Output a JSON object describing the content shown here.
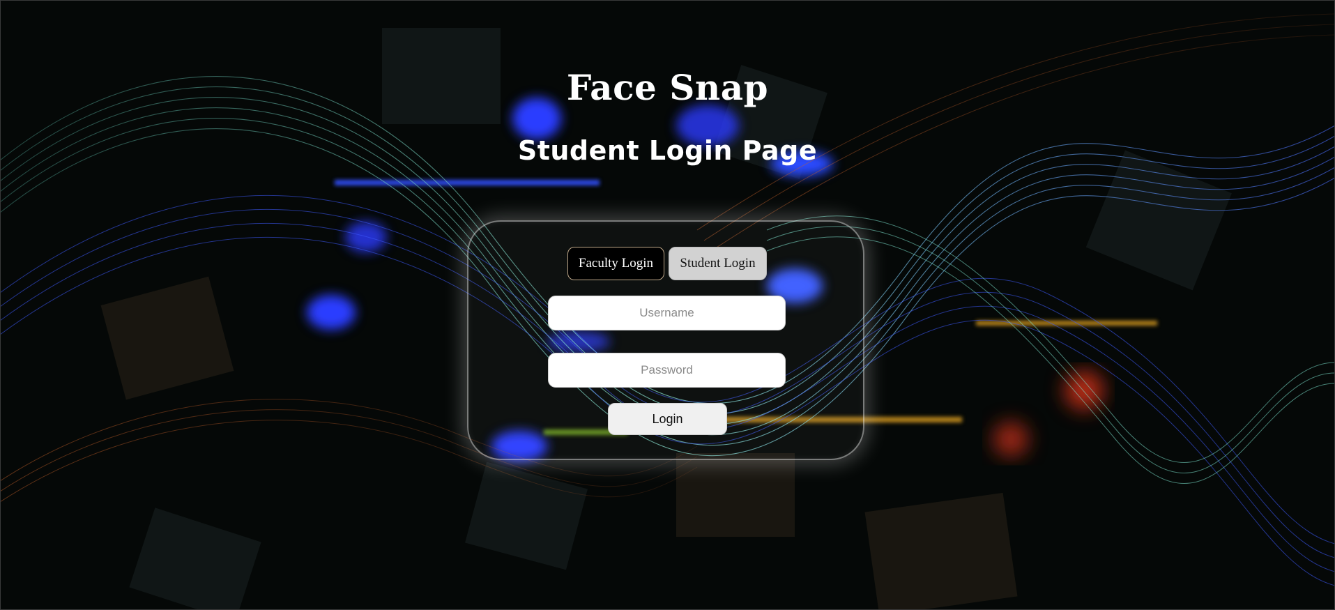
{
  "app": {
    "title": "Face Snap",
    "subtitle": "Student Login Page"
  },
  "login_card": {
    "tabs": [
      {
        "label": "Faculty Login",
        "active": false
      },
      {
        "label": "Student Login",
        "active": true
      }
    ],
    "username": {
      "value": "",
      "placeholder": "Username"
    },
    "password": {
      "value": "",
      "placeholder": "Password"
    },
    "submit_label": "Login"
  },
  "colors": {
    "background": "#050807",
    "accent_blue": "#2f4bff",
    "accent_teal": "#6fe0c8",
    "accent_orange": "#e0782a",
    "text": "#ffffff",
    "active_tab": "#d2d2d2"
  },
  "background_art": "abstract-waves"
}
